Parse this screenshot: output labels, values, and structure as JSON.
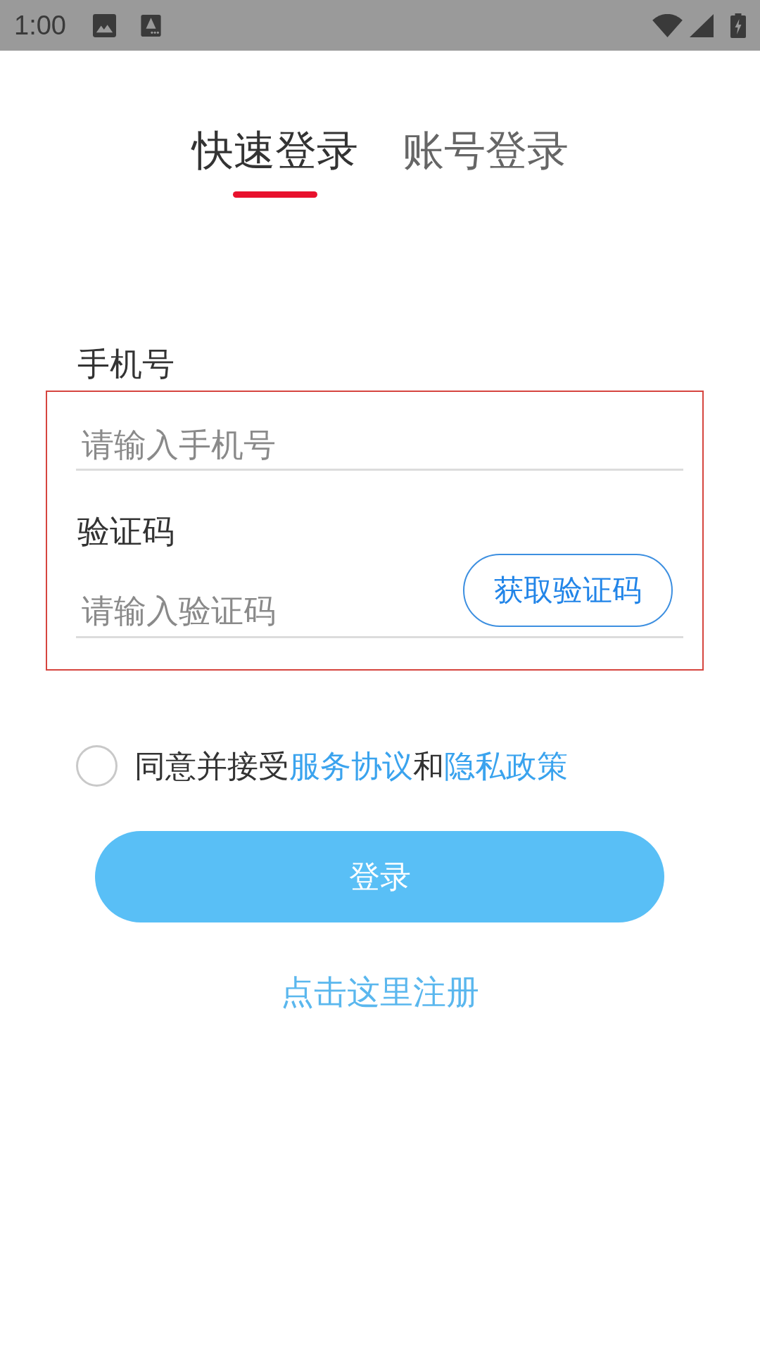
{
  "status_bar": {
    "time": "1:00"
  },
  "tabs": [
    {
      "label": "快速登录",
      "selected": true
    },
    {
      "label": "账号登录",
      "selected": false
    }
  ],
  "phone": {
    "label": "手机号",
    "placeholder": "请输入手机号"
  },
  "code": {
    "label": "验证码",
    "placeholder": "请输入验证码",
    "button": "获取验证码"
  },
  "agreement": {
    "checked": false,
    "parts": [
      {
        "kind": "text",
        "text": "同意并接受"
      },
      {
        "kind": "link",
        "text": "服务协议"
      },
      {
        "kind": "text",
        "text": "和"
      },
      {
        "kind": "link",
        "text": "隐私政策"
      }
    ]
  },
  "login_button": "登录",
  "register_link": "点击这里注册"
}
